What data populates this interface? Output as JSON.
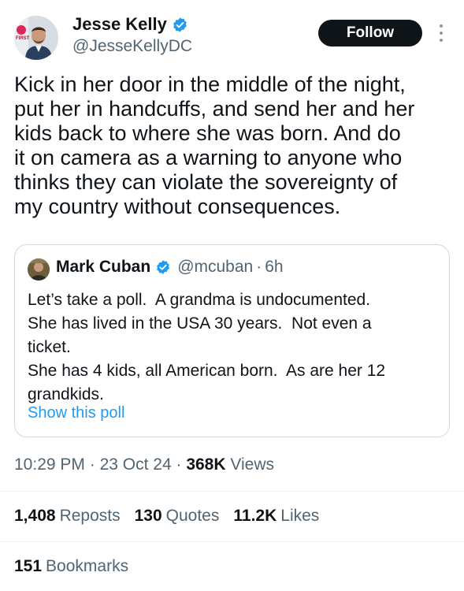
{
  "author": {
    "display_name": "Jesse Kelly",
    "handle": "@JesseKellyDC",
    "avatar_badge": "FIRST",
    "verified_color": "#1d9bf0"
  },
  "header": {
    "follow_label": "Follow",
    "more_icon": "more-vertical-icon"
  },
  "tweet": {
    "text": "Kick in her door in the middle of the night,\nput her in handcuffs, and send her and her\nkids back to where she was born. And do\nit on camera as a warning to anyone who\nthinks they can violate the sovereignty of\nmy country without consequences."
  },
  "quote": {
    "display_name": "Mark Cuban",
    "handle": "@mcuban",
    "separator": "·",
    "time": "6h",
    "text": "Let’s take a poll.  A grandma is undocumented.\nShe has lived in the USA 30 years.  Not even a\nticket.\nShe has 4 kids, all American born.  As are her 12\ngrandkids.",
    "show_poll_label": "Show this poll"
  },
  "meta": {
    "time": "10:29 PM",
    "sep1": "·",
    "date": "23 Oct 24",
    "sep2": "·",
    "views_count": "368K",
    "views_label": "Views"
  },
  "stats": {
    "reposts_count": "1,408",
    "reposts_label": "Reposts",
    "quotes_count": "130",
    "quotes_label": "Quotes",
    "likes_count": "11.2K",
    "likes_label": "Likes",
    "bookmarks_count": "151",
    "bookmarks_label": "Bookmarks"
  },
  "colors": {
    "text_primary": "#0f1419",
    "text_secondary": "#536471",
    "link": "#1d9bf0",
    "border": "#cfd9de"
  }
}
